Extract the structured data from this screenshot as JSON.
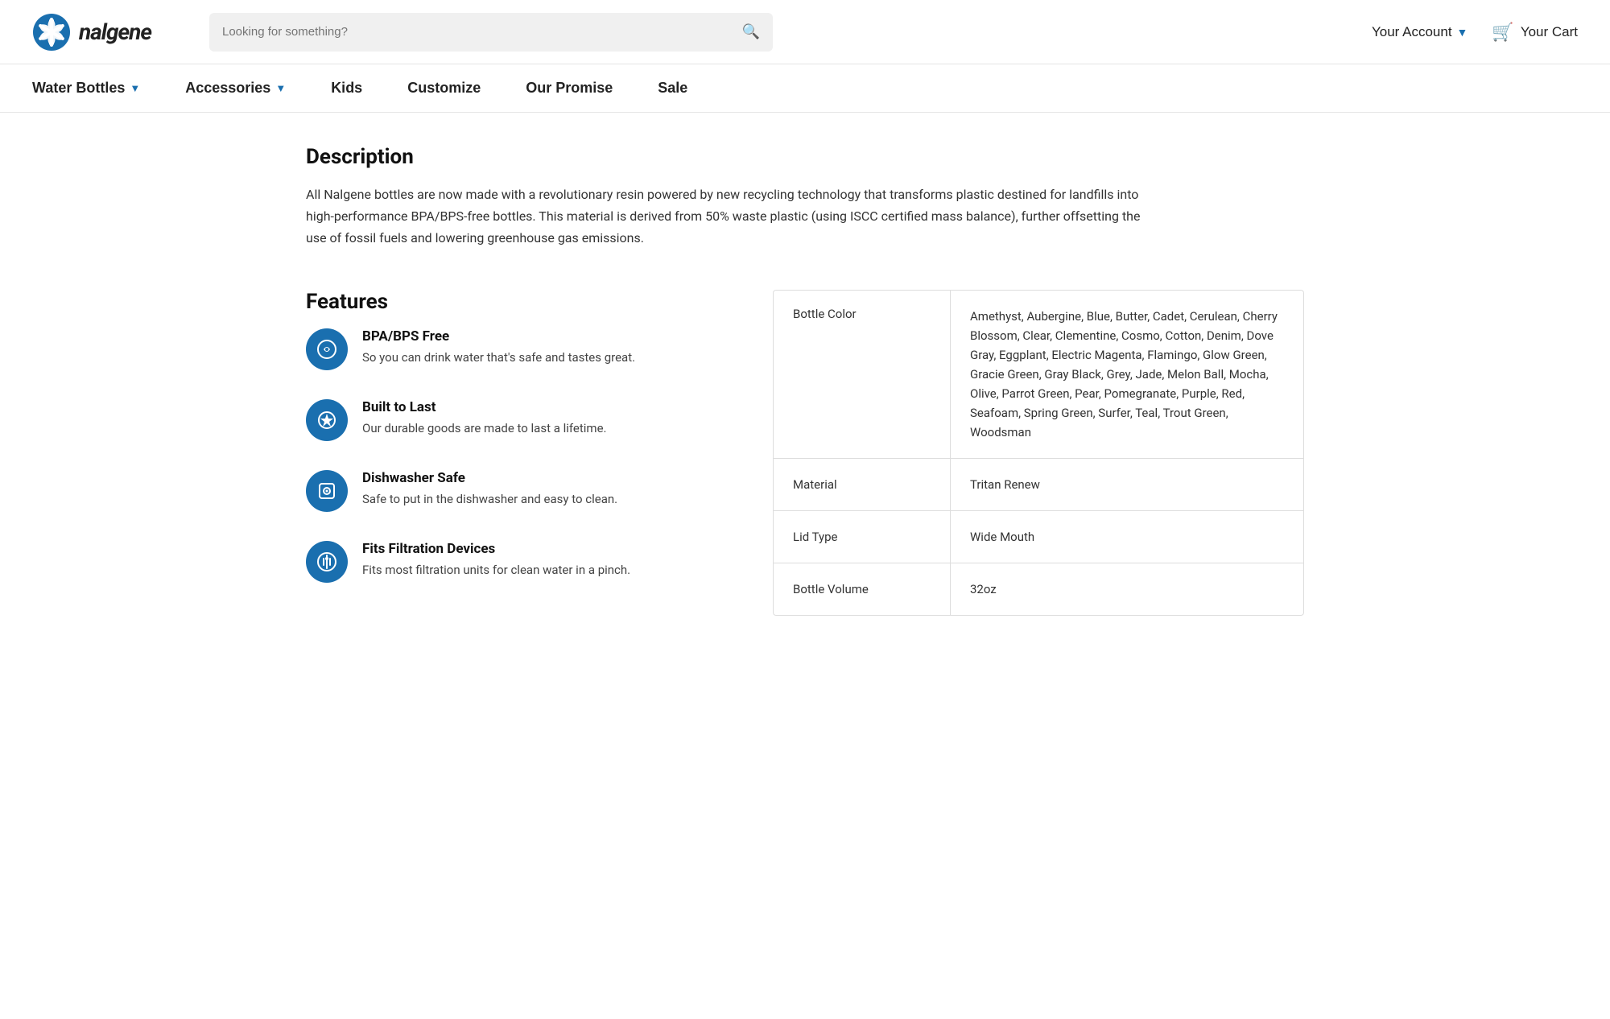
{
  "header": {
    "logo_text": "nalgene",
    "search_placeholder": "Looking for something?",
    "account_label": "Your Account",
    "cart_label": "Your Cart"
  },
  "nav": {
    "items": [
      {
        "label": "Water Bottles",
        "has_dropdown": true
      },
      {
        "label": "Accessories",
        "has_dropdown": true
      },
      {
        "label": "Kids",
        "has_dropdown": false
      },
      {
        "label": "Customize",
        "has_dropdown": false
      },
      {
        "label": "Our Promise",
        "has_dropdown": false
      },
      {
        "label": "Sale",
        "has_dropdown": false
      }
    ]
  },
  "description": {
    "title": "Description",
    "text": "All Nalgene bottles are now made with a revolutionary resin powered by new recycling technology that transforms plastic destined for landfills into high-performance BPA/BPS-free bottles. This material is derived from 50% waste plastic (using ISCC certified mass balance), further offsetting the use of fossil fuels and lowering greenhouse gas emissions."
  },
  "features": {
    "title": "Features",
    "items": [
      {
        "icon": "💧",
        "title": "BPA/BPS Free",
        "description": "So you can drink water that's safe and tastes great."
      },
      {
        "icon": "🔄",
        "title": "Built to Last",
        "description": "Our durable goods are made to last a lifetime."
      },
      {
        "icon": "🍽",
        "title": "Dishwasher Safe",
        "description": "Safe to put in the dishwasher and easy to clean."
      },
      {
        "icon": "🔍",
        "title": "Fits Filtration Devices",
        "description": "Fits most filtration units for clean water in a pinch."
      }
    ]
  },
  "specs": {
    "rows": [
      {
        "label": "Bottle Color",
        "value": "Amethyst, Aubergine, Blue, Butter, Cadet, Cerulean, Cherry Blossom, Clear, Clementine, Cosmo, Cotton, Denim, Dove Gray, Eggplant, Electric Magenta, Flamingo, Glow Green, Gracie Green, Gray Black, Grey, Jade, Melon Ball, Mocha, Olive, Parrot Green, Pear, Pomegranate, Purple, Red, Seafoam, Spring Green, Surfer, Teal, Trout Green, Woodsman"
      },
      {
        "label": "Material",
        "value": "Tritan Renew"
      },
      {
        "label": "Lid Type",
        "value": "Wide Mouth"
      },
      {
        "label": "Bottle Volume",
        "value": "32oz"
      }
    ]
  }
}
